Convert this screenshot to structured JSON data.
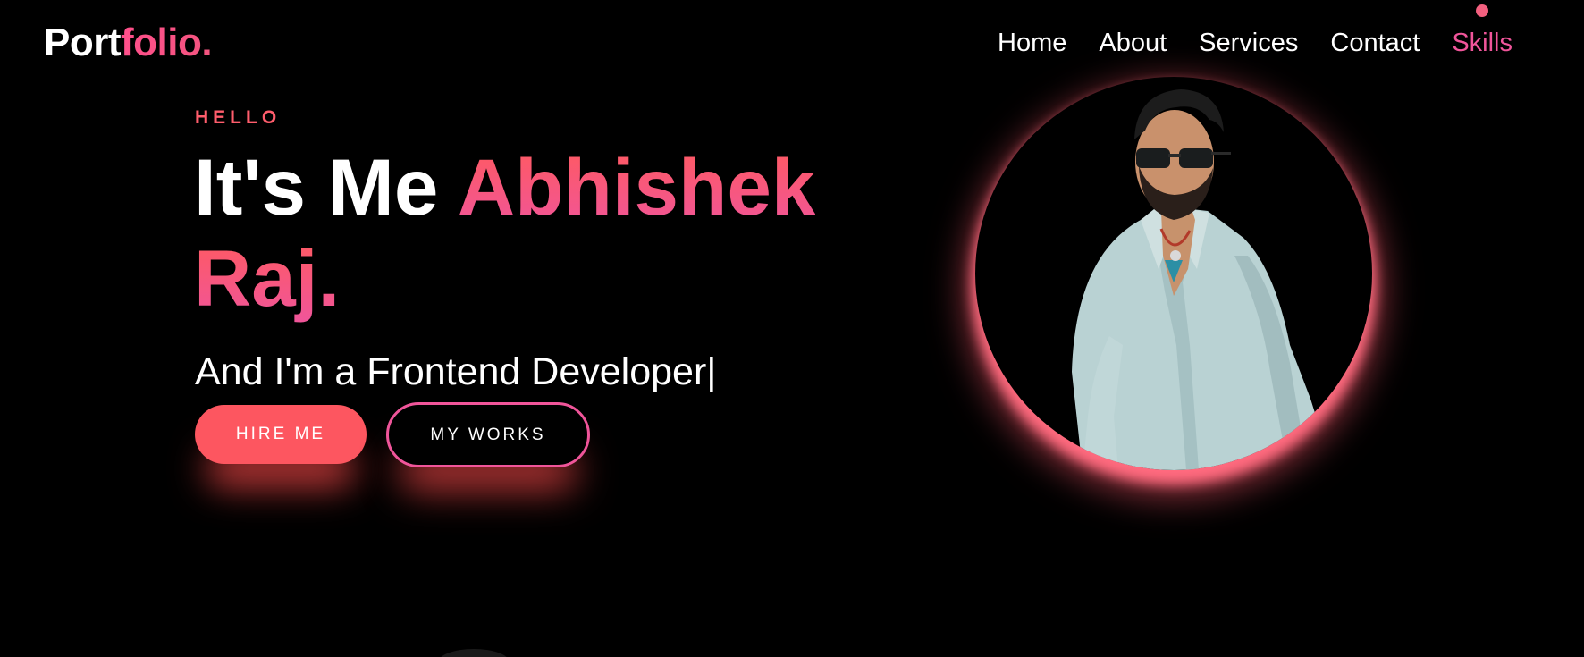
{
  "header": {
    "logo": {
      "part_a": "Port",
      "part_b": "folio."
    },
    "nav": [
      {
        "label": "Home",
        "active": false
      },
      {
        "label": "About",
        "active": false
      },
      {
        "label": "Services",
        "active": false
      },
      {
        "label": "Contact",
        "active": false
      },
      {
        "label": "Skills",
        "active": true
      }
    ]
  },
  "hero": {
    "greeting": "HELLO",
    "headline_prefix": "It's Me ",
    "headline_name_line1": "Abhishek",
    "headline_name_line2": "Raj.",
    "subline": "And I'm a Frontend Developer|",
    "buttons": {
      "hire": "HIRE ME",
      "works": "MY WORKS"
    }
  },
  "portrait": {
    "icon": "person-photo"
  },
  "colors": {
    "background": "#000000",
    "accent_pink": "#f0559a",
    "accent_coral": "#fd5660",
    "text": "#ffffff"
  }
}
